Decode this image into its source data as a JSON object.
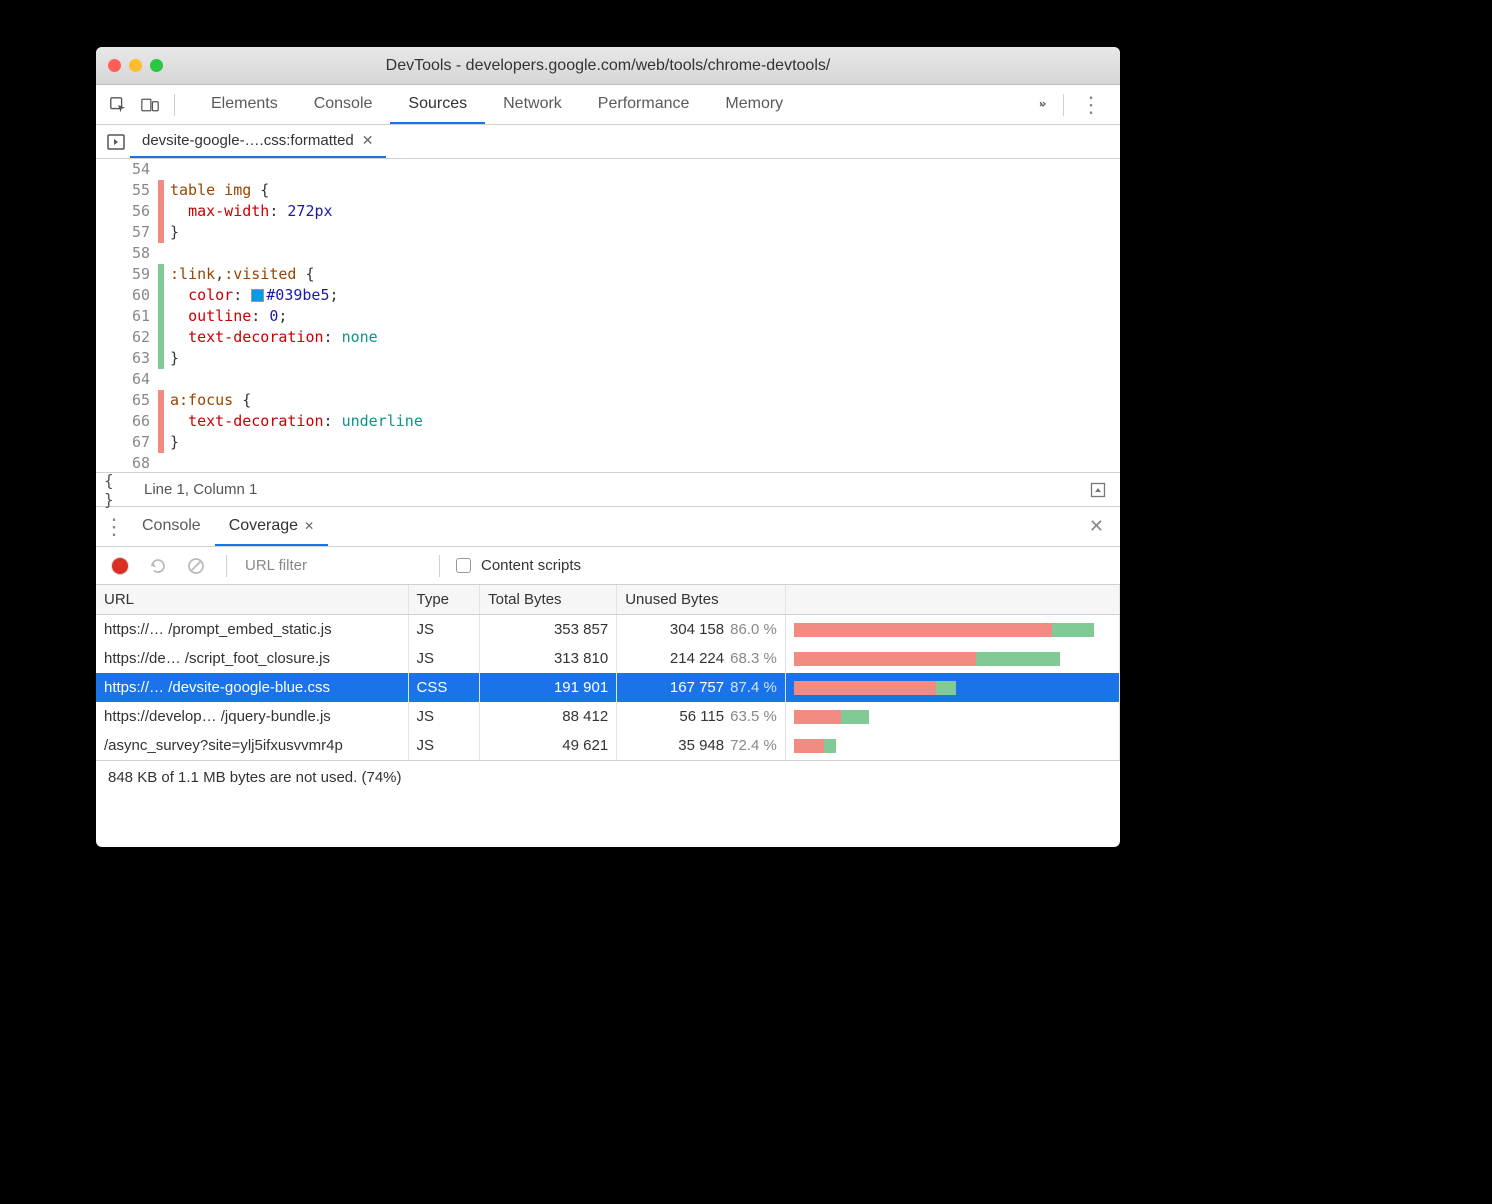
{
  "titlebar": {
    "title": "DevTools - developers.google.com/web/tools/chrome-devtools/"
  },
  "main_tabs": {
    "items": [
      "Elements",
      "Console",
      "Sources",
      "Network",
      "Performance",
      "Memory"
    ],
    "active_index": 2
  },
  "source_tab": {
    "label": "devsite-google-….css:formatted"
  },
  "code": {
    "lines": [
      {
        "n": "54",
        "cov": "",
        "html": ""
      },
      {
        "n": "55",
        "cov": "red",
        "html": "<span class='k-sel'>table img</span> {"
      },
      {
        "n": "56",
        "cov": "red",
        "html": "  <span class='k-prop'>max-width</span>: <span class='k-val'>272px</span>"
      },
      {
        "n": "57",
        "cov": "red",
        "html": "}"
      },
      {
        "n": "58",
        "cov": "",
        "html": ""
      },
      {
        "n": "59",
        "cov": "green",
        "html": "<span class='k-sel'>:link</span>,<span class='k-sel'>:visited</span> {"
      },
      {
        "n": "60",
        "cov": "green",
        "html": "  <span class='k-prop'>color</span>: <span class='swatch' style='background:#039be5'></span><span class='k-val'>#039be5</span>;"
      },
      {
        "n": "61",
        "cov": "green",
        "html": "  <span class='k-prop'>outline</span>: <span class='k-val'>0</span>;"
      },
      {
        "n": "62",
        "cov": "green",
        "html": "  <span class='k-prop'>text-decoration</span>: <span class='k-none'>none</span>"
      },
      {
        "n": "63",
        "cov": "green",
        "html": "}"
      },
      {
        "n": "64",
        "cov": "",
        "html": ""
      },
      {
        "n": "65",
        "cov": "red",
        "html": "<span class='k-sel'>a:focus</span> {"
      },
      {
        "n": "66",
        "cov": "red",
        "html": "  <span class='k-prop'>text-decoration</span>: <span class='k-none'>underline</span>"
      },
      {
        "n": "67",
        "cov": "red",
        "html": "}"
      },
      {
        "n": "68",
        "cov": "",
        "html": ""
      }
    ]
  },
  "code_status": "Line 1, Column 1",
  "drawer": {
    "tabs": [
      "Console",
      "Coverage"
    ],
    "active_index": 1
  },
  "coverage": {
    "filter_placeholder": "URL filter",
    "content_scripts_label": "Content scripts",
    "columns": [
      "URL",
      "Type",
      "Total Bytes",
      "Unused Bytes",
      ""
    ],
    "rows": [
      {
        "url": "https://… /prompt_embed_static.js",
        "type": "JS",
        "total": "353 857",
        "unused": "304 158",
        "pct": "86.0 %",
        "bar_u": 0.86,
        "bar_scale": 1.0,
        "sel": false
      },
      {
        "url": "https://de… /script_foot_closure.js",
        "type": "JS",
        "total": "313 810",
        "unused": "214 224",
        "pct": "68.3 %",
        "bar_u": 0.683,
        "bar_scale": 0.887,
        "sel": false
      },
      {
        "url": "https://… /devsite-google-blue.css",
        "type": "CSS",
        "total": "191 901",
        "unused": "167 757",
        "pct": "87.4 %",
        "bar_u": 0.874,
        "bar_scale": 0.542,
        "sel": true
      },
      {
        "url": "https://develop… /jquery-bundle.js",
        "type": "JS",
        "total": "88 412",
        "unused": "56 115",
        "pct": "63.5 %",
        "bar_u": 0.635,
        "bar_scale": 0.25,
        "sel": false
      },
      {
        "url": "/async_survey?site=ylj5ifxusvvmr4p",
        "type": "JS",
        "total": "49 621",
        "unused": "35 948",
        "pct": "72.4 %",
        "bar_u": 0.724,
        "bar_scale": 0.14,
        "sel": false
      }
    ],
    "footer": "848 KB of 1.1 MB bytes are not used. (74%)"
  }
}
